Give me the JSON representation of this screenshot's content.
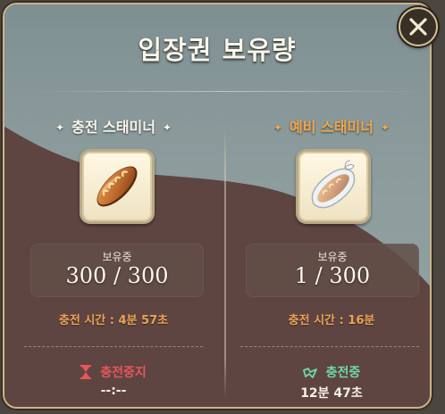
{
  "dialog": {
    "title": "입장권 보유량",
    "close_icon": "close-icon"
  },
  "charge_stamina": {
    "title": "충전 스태미너",
    "title_color": "#fbf6ea",
    "sparkle_icon": "sparkle-icon",
    "item_icon": "bread-icon",
    "held_label": "보유중",
    "held_value": "300 / 300",
    "charge_time": "충전 시간 : 4분 57초",
    "status_icon": "hourglass-icon",
    "status_label": "충전중지",
    "status_color": "#e8555a",
    "status_time": "--:--"
  },
  "reserve_stamina": {
    "title": "예비 스태미너",
    "title_color": "#f0a84c",
    "sparkle_icon": "sparkle-icon",
    "item_icon": "wrapped-bread-icon",
    "held_label": "보유중",
    "held_value": "1 / 300",
    "charge_time": "충전 시간 : 16분",
    "status_icon": "charging-icon",
    "status_label": "충전중",
    "status_color": "#6fd9a4",
    "status_time": "12분 47초"
  }
}
